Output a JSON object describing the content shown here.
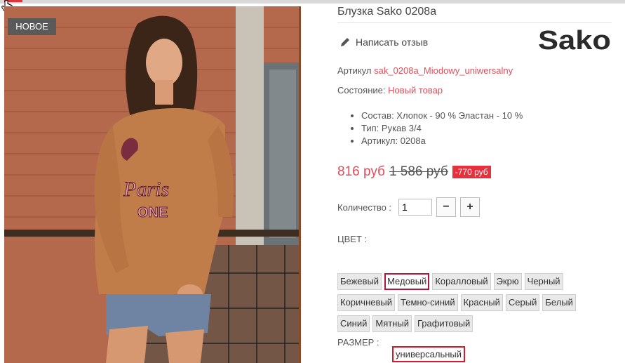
{
  "badge": "НОВОЕ",
  "product": {
    "title": "Блузка Sako 0208a",
    "review_label": "Написать отзыв",
    "brand": "Sako",
    "sku_label": "Артикул",
    "sku_value": "sak_0208a_Miodowy_uniwersalny",
    "condition_label": "Состояние:",
    "condition_value": "Новый товар",
    "features": [
      "Состав: Хлопок - 90 % Эластан - 10 %",
      "Тип: Рукав 3/4",
      "Артикул: 0208a"
    ],
    "price_new": "816 руб",
    "price_old": "1 586 руб",
    "discount": "-770 руб",
    "quantity_label": "Количество :",
    "quantity_value": "1",
    "minus": "−",
    "plus": "+",
    "color_label": "ЦВЕТ :",
    "colors": [
      [
        "Бежевый",
        "Медовый",
        "Коралловый",
        "Экрю",
        "Черный"
      ],
      [
        "Коричневый",
        "Темно-синий",
        "Красный",
        "Серый",
        "Белый"
      ],
      [
        "Синий",
        "Мятный",
        "Графитовый"
      ]
    ],
    "selected_color": "Медовый",
    "size_label": "РАЗМЕР :",
    "size_value": "универсальный"
  },
  "colors": {
    "accent": "#e04e5a",
    "discount_bg": "#e6303d",
    "selected_border": "#b2153a"
  }
}
